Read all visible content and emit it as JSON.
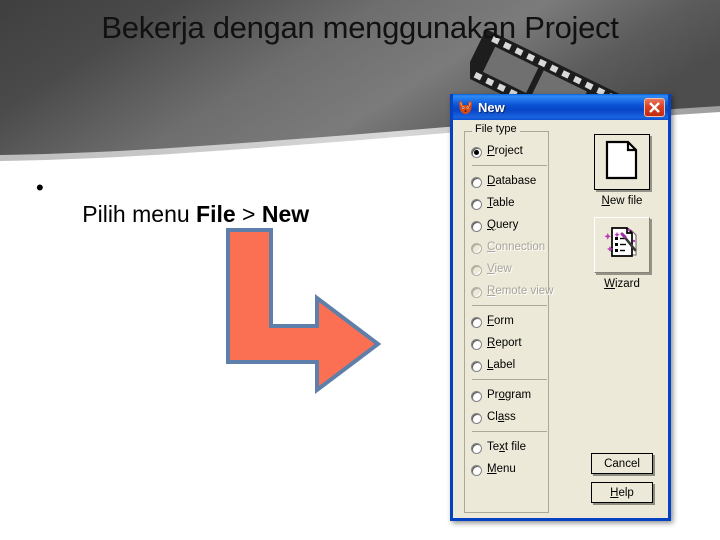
{
  "slide": {
    "title": "Bekerja dengan menggunakan Project",
    "bullet": {
      "marker": "•",
      "prefix": "Pilih menu ",
      "bold1": "File",
      "middle": " > ",
      "bold2": "New"
    },
    "colors": {
      "header_dark": "#474747",
      "header_mid": "#6f6f6f",
      "header_rim": "#c9c9c9",
      "arrow_fill": "#fb7052",
      "arrow_stroke": "#5f7fab"
    },
    "decorations": {
      "film_strip": "film-strip-decoration",
      "arrow": "bent-arrow-down-right"
    }
  },
  "dialog": {
    "title": "New",
    "app_icon": "fox-icon",
    "close_label": "Close",
    "colors": {
      "titlebar_blue": "#0b54d6",
      "face": "#ece9d8",
      "border": "#0442c4",
      "close_red": "#d84123"
    },
    "group": {
      "legend": "File type",
      "options": [
        {
          "label": "Project",
          "accel": "P",
          "checked": true,
          "enabled": true,
          "sep_after": true
        },
        {
          "label": "Database",
          "accel": "D",
          "checked": false,
          "enabled": true,
          "sep_after": false
        },
        {
          "label": "Table",
          "accel": "T",
          "checked": false,
          "enabled": true,
          "sep_after": false
        },
        {
          "label": "Query",
          "accel": "Q",
          "checked": false,
          "enabled": true,
          "sep_after": false
        },
        {
          "label": "Connection",
          "accel": "C",
          "checked": false,
          "enabled": false,
          "sep_after": false
        },
        {
          "label": "View",
          "accel": "V",
          "checked": false,
          "enabled": false,
          "sep_after": false
        },
        {
          "label": "Remote view",
          "accel": "R",
          "checked": false,
          "enabled": false,
          "sep_after": true
        },
        {
          "label": "Form",
          "accel": "F",
          "checked": false,
          "enabled": true,
          "sep_after": false
        },
        {
          "label": "Report",
          "accel": "R",
          "checked": false,
          "enabled": true,
          "sep_after": false
        },
        {
          "label": "Label",
          "accel": "L",
          "checked": false,
          "enabled": true,
          "sep_after": true
        },
        {
          "label": "Program",
          "accel": "o",
          "checked": false,
          "enabled": true,
          "sep_after": false
        },
        {
          "label": "Class",
          "accel": "a",
          "checked": false,
          "enabled": true,
          "sep_after": true
        },
        {
          "label": "Text file",
          "accel": "x",
          "checked": false,
          "enabled": true,
          "sep_after": false
        },
        {
          "label": "Menu",
          "accel": "M",
          "checked": false,
          "enabled": true,
          "sep_after": false
        }
      ]
    },
    "actions": {
      "new_file": {
        "caption": "New file",
        "accel": "N",
        "icon": "document-page-icon"
      },
      "wizard": {
        "caption": "Wizard",
        "accel": "W",
        "icon": "magic-wand-document-icon"
      },
      "cancel": {
        "caption": "Cancel",
        "accel": ""
      },
      "help": {
        "caption": "Help",
        "accel": "H"
      }
    }
  }
}
